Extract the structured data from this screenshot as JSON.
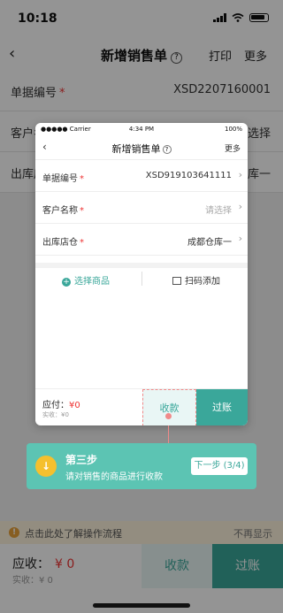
{
  "status": {
    "time": "10:18"
  },
  "nav": {
    "back": "‹",
    "title": "新增销售单",
    "help": "?",
    "print": "打印",
    "more": "更多"
  },
  "form": {
    "doc_no": {
      "label": "单据编号",
      "value": "XSD2207160001"
    },
    "customer": {
      "label": "客户名称",
      "value": "请选择"
    },
    "warehouse": {
      "label": "出库店仓",
      "value": "成都仓库一"
    }
  },
  "tip": {
    "text": "点击此处了解操作流程",
    "dismiss": "不再显示",
    "icon": "!"
  },
  "bottom": {
    "receivable_label": "应收：",
    "receivable_amount": "¥ 0",
    "actual": "实收：¥ 0",
    "collect": "收款",
    "post": "过账"
  },
  "preview": {
    "status": {
      "carrier": "●●●●● Carrier",
      "time": "4:34 PM",
      "battery": "100%"
    },
    "nav": {
      "back": "‹",
      "title": "新增销售单",
      "help": "?",
      "more": "更多"
    },
    "rows": [
      {
        "label": "单据编号",
        "value": "XSD919103641111",
        "placeholder": false
      },
      {
        "label": "客户名称",
        "value": "请选择",
        "placeholder": true
      },
      {
        "label": "出库店仓",
        "value": "成都仓库一",
        "placeholder": false
      }
    ],
    "select_goods": "选择商品",
    "scan_add": "扫码添加",
    "pay_label": "应付：",
    "pay_amount": "¥0",
    "actual": "实收：¥0",
    "collect": "收款",
    "post": "过账"
  },
  "guide": {
    "step": "第三步",
    "desc": "请对销售的商品进行收款",
    "next": "下一步 (3/4)"
  },
  "colors": {
    "accent": "#3aa79a",
    "guide_bg": "#5cc4b3",
    "required": "#e33333",
    "tip_bg": "#fdf3dc"
  }
}
